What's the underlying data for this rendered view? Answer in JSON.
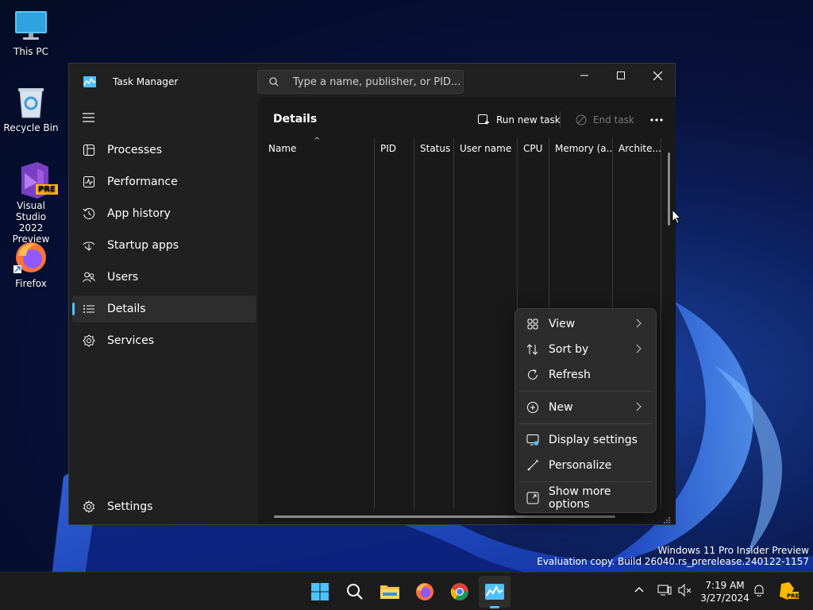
{
  "desktop": {
    "icons": [
      {
        "label": "This PC",
        "icon": "monitor-icon"
      },
      {
        "label": "Recycle Bin",
        "icon": "recycle-bin-icon"
      },
      {
        "label": "Visual Studio 2022 Preview",
        "line1": "Visual Studio",
        "line2": "2022 Preview",
        "badge": "PRE",
        "icon": "visual-studio-icon"
      },
      {
        "label": "Firefox",
        "icon": "firefox-icon"
      }
    ]
  },
  "window": {
    "title": "Task Manager",
    "search_placeholder": "Type a name, publisher, or PID...",
    "controls": {
      "minimize": "minimize-icon",
      "maximize": "maximize-icon",
      "close": "close-icon"
    }
  },
  "sidebar": {
    "items": [
      {
        "label": "Processes",
        "icon": "processes-icon"
      },
      {
        "label": "Performance",
        "icon": "performance-icon"
      },
      {
        "label": "App history",
        "icon": "history-icon"
      },
      {
        "label": "Startup apps",
        "icon": "startup-icon"
      },
      {
        "label": "Users",
        "icon": "users-icon"
      },
      {
        "label": "Details",
        "icon": "details-icon",
        "active": true
      },
      {
        "label": "Services",
        "icon": "services-icon"
      }
    ],
    "settings_label": "Settings"
  },
  "main": {
    "title": "Details",
    "run_new_task": "Run new task",
    "end_task": "End task",
    "columns": [
      "Name",
      "PID",
      "Status",
      "User name",
      "CPU",
      "Memory (a...",
      "Archite..."
    ]
  },
  "context_menu": {
    "items": [
      {
        "label": "View",
        "icon": "view-grid-icon",
        "submenu": true
      },
      {
        "label": "Sort by",
        "icon": "sort-icon",
        "submenu": true
      },
      {
        "label": "Refresh",
        "icon": "refresh-icon",
        "submenu": false
      },
      {
        "label": "New",
        "icon": "new-plus-icon",
        "submenu": true
      },
      {
        "label": "Display settings",
        "icon": "display-settings-icon",
        "submenu": false
      },
      {
        "label": "Personalize",
        "icon": "personalize-brush-icon",
        "submenu": false
      },
      {
        "label": "Show more options",
        "icon": "more-options-icon",
        "submenu": false
      }
    ]
  },
  "watermark": {
    "line1": "Windows 11 Pro Insider Preview",
    "line2": "Evaluation copy. Build 26040.rs_prerelease.240122-1157"
  },
  "taskbar": {
    "time": "7:19 AM",
    "date": "3/27/2024"
  },
  "colors": {
    "accent": "#4cc2ff",
    "window_bg": "#202020",
    "content_bg": "#191919",
    "menu_bg": "#2c2c2c"
  }
}
